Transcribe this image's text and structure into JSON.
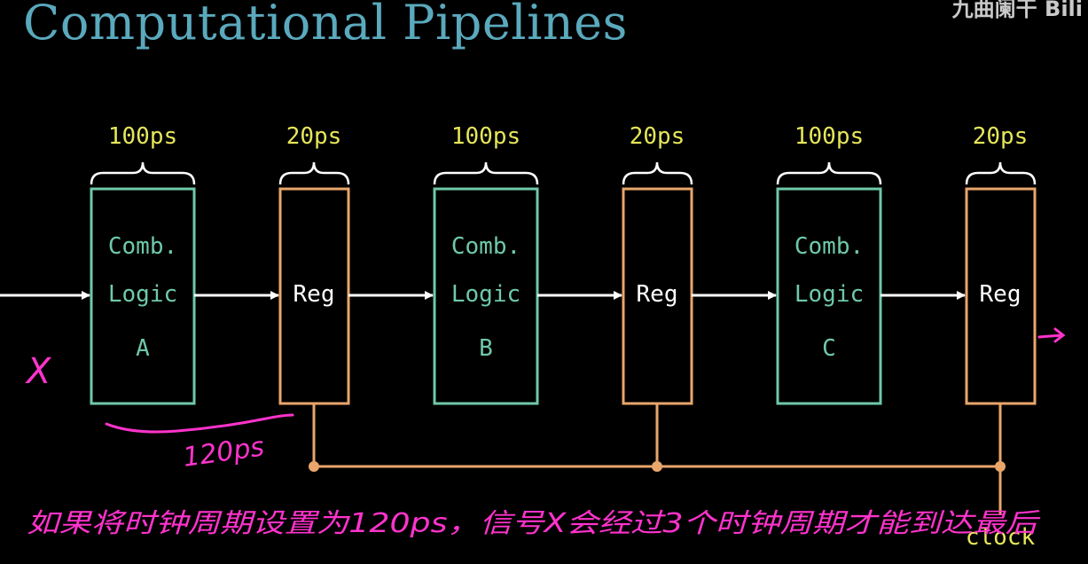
{
  "header": {
    "title": "Computational Pipelines",
    "watermark": "九曲阑干 Bili"
  },
  "diagram": {
    "colors": {
      "logic": "#6fc9a8",
      "register": "#e9a66b",
      "timing_label": "#e6e65a",
      "wire": "#ffffff",
      "clock_wire": "#e9a66b",
      "annotation": "#ff33cc"
    },
    "timing_labels": [
      "100ps",
      "20ps",
      "100ps",
      "20ps",
      "100ps",
      "20ps"
    ],
    "logic_blocks": [
      {
        "line1": "Comb.",
        "line2": "Logic",
        "line3": "A"
      },
      {
        "line1": "Comb.",
        "line2": "Logic",
        "line3": "B"
      },
      {
        "line1": "Comb.",
        "line2": "Logic",
        "line3": "C"
      }
    ],
    "registers": [
      "Reg",
      "Reg",
      "Reg"
    ],
    "clock_label": "clock"
  },
  "annotations": {
    "input_mark": "X",
    "output_arrow": "→",
    "brace_note": "120ps",
    "bottom_note": "如果将时钟周期设置为120ps，信号X会经过3个时钟周期才能到达最后"
  }
}
